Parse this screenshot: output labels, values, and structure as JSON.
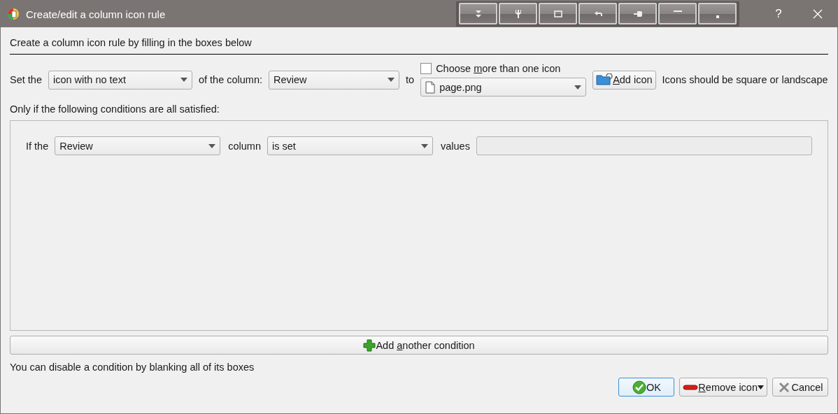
{
  "window": {
    "title": "Create/edit a column icon rule",
    "help": "?"
  },
  "heading": "Create a column icon rule by filling in the boxes below",
  "rule_row": {
    "prefix": "Set the",
    "kind_select": {
      "value": "icon with no text"
    },
    "column_label": "of the column:",
    "column_select": {
      "value": "Review"
    },
    "to_label": "to",
    "multiple": {
      "checked": false,
      "label_parts": [
        {
          "text": "Choose ",
          "underline": false
        },
        {
          "text": "m",
          "underline": true
        },
        {
          "text": "ore than one icon",
          "underline": false
        }
      ]
    },
    "icon_select": {
      "value": "page.png"
    },
    "add_icon_button": {
      "label_parts": [
        {
          "text": "A",
          "underline": true
        },
        {
          "text": "dd icon",
          "underline": false
        }
      ]
    },
    "hint": "Icons should be square or landscape"
  },
  "conditions_label": "Only if the following conditions are all satisfied:",
  "conditions": [
    {
      "prefix": "If the",
      "column": "Review",
      "column_label": "column",
      "action": "is set",
      "values_label": "values"
    }
  ],
  "add_condition_button": {
    "label_parts": [
      {
        "text": "Add ",
        "underline": false
      },
      {
        "text": "a",
        "underline": true
      },
      {
        "text": "nother condition",
        "underline": false
      }
    ]
  },
  "footer_note": "You can disable a condition by blanking all of its boxes",
  "buttons": [
    {
      "kind": "ok",
      "default": true,
      "menu": false,
      "label_parts": [
        {
          "text": "OK",
          "underline": false
        }
      ]
    },
    {
      "kind": "remove",
      "default": false,
      "menu": true,
      "label_parts": [
        {
          "text": "R",
          "underline": true
        },
        {
          "text": "emove icon",
          "underline": false
        }
      ]
    },
    {
      "kind": "cancel",
      "default": false,
      "menu": false,
      "label_parts": [
        {
          "text": "Cancel",
          "underline": false
        }
      ]
    }
  ]
}
